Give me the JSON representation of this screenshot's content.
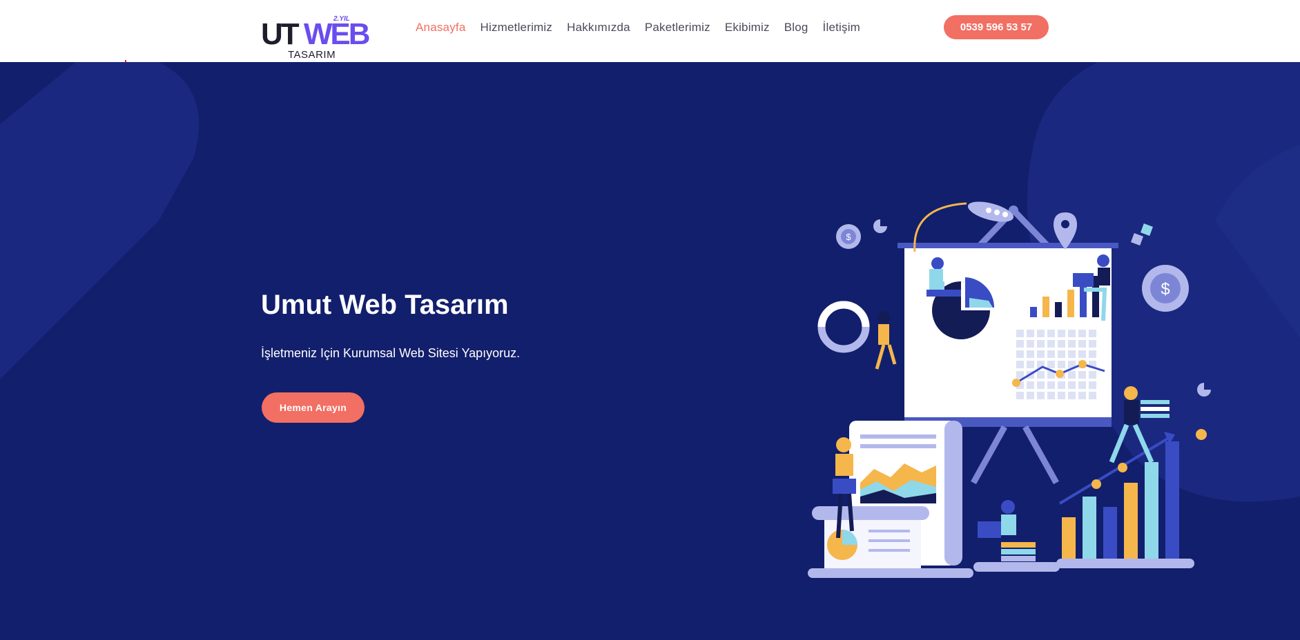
{
  "header": {
    "logo": {
      "main_prefix": "UT",
      "main_suffix": "WEB",
      "badge": "2.YIL",
      "subtitle": "TASARIM"
    },
    "nav": [
      {
        "label": "Anasayfa",
        "active": true
      },
      {
        "label": "Hizmetlerimiz",
        "active": false
      },
      {
        "label": "Hakkımızda",
        "active": false
      },
      {
        "label": "Paketlerimiz",
        "active": false
      },
      {
        "label": "Ekibimiz",
        "active": false
      },
      {
        "label": "Blog",
        "active": false
      },
      {
        "label": "İletişim",
        "active": false
      }
    ],
    "phone_button": "0539 596 53 57"
  },
  "hero": {
    "title": "Umut Web Tasarım",
    "subtitle": "İşletmeniz Için Kurumsal Web Sitesi Yapıyoruz.",
    "cta_button": "Hemen Arayın"
  },
  "colors": {
    "accent": "#f26f63",
    "hero_background": "#121f6c",
    "brand_purple": "#6a4dee"
  },
  "illustration": {
    "icons": [
      "rocket-icon",
      "location-pin-icon",
      "dollar-gear-icon",
      "puzzle-icon",
      "pie-chart-icon",
      "bar-chart-icon",
      "line-chart-icon",
      "donut-chart-icon",
      "laptop-icon"
    ]
  }
}
